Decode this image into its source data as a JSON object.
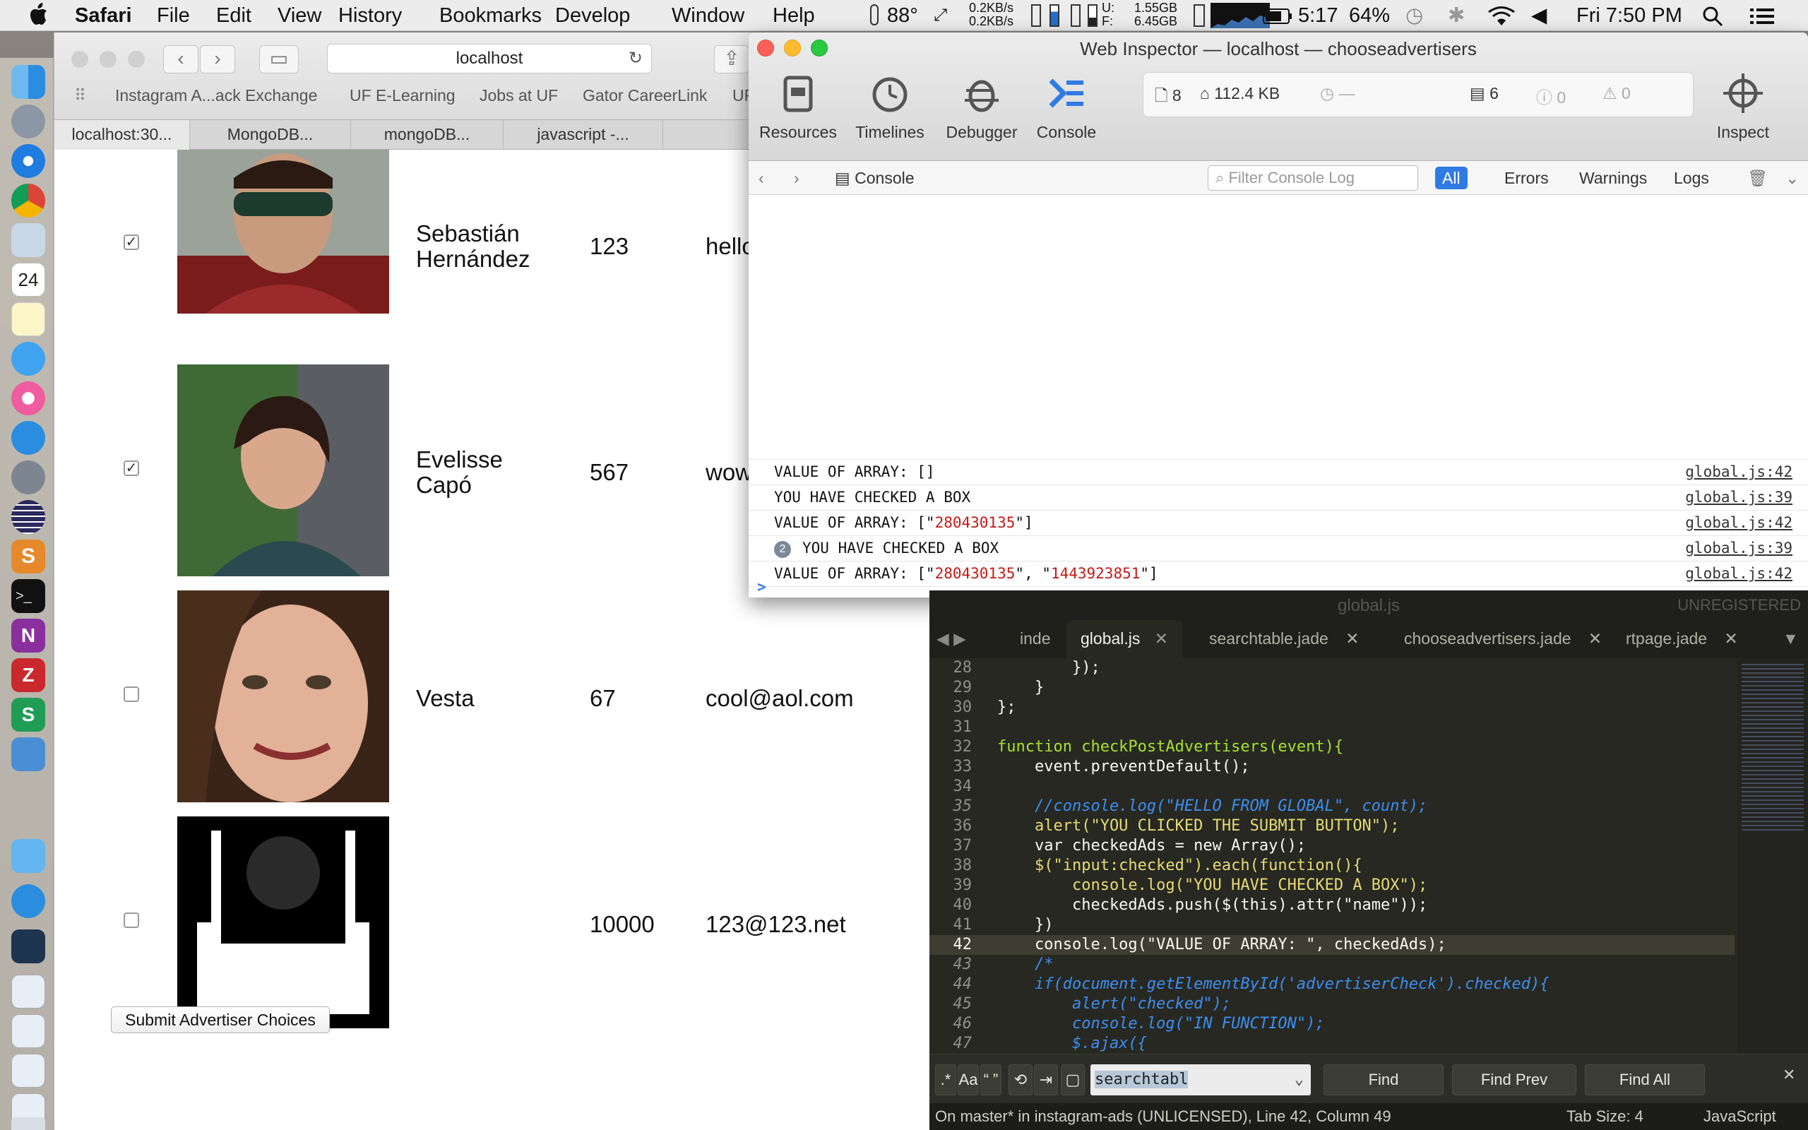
{
  "menubar": {
    "app": "Safari",
    "menus": [
      "File",
      "Edit",
      "View",
      "History",
      "Bookmarks",
      "Develop",
      "Window",
      "Help"
    ],
    "temp": "88°",
    "net_up": "0.2KB/s",
    "net_down": "0.2KB/s",
    "mem_u_label": "U:",
    "mem_f_label": "F:",
    "mem_used": "1.55GB",
    "mem_free": "6.45GB",
    "time": "5:17",
    "battery": "64%",
    "clock": "Fri 7:50 PM"
  },
  "safari": {
    "url": "localhost",
    "bookmarks": [
      "Instagram A...ack Exchange",
      "UF E-Learning",
      "Jobs at UF",
      "Gator CareerLink",
      "UF"
    ],
    "tabs": [
      "localhost:30...",
      "MongoDB...",
      "mongoDB...",
      "javascript -..."
    ]
  },
  "page": {
    "rows": [
      {
        "checked": true,
        "first": "Sebastián",
        "last": "Hernández",
        "number": "123",
        "email": "hello"
      },
      {
        "checked": true,
        "first": "Evelisse",
        "last": "Capó",
        "number": "567",
        "email": "wow"
      },
      {
        "checked": false,
        "first": "Vesta",
        "last": "",
        "number": "67",
        "email": "cool@aol.com"
      },
      {
        "checked": false,
        "first": "",
        "last": "",
        "number": "10000",
        "email": "123@123.net"
      }
    ],
    "submit_label": "Submit Advertiser Choices"
  },
  "inspector": {
    "title": "Web Inspector — localhost — chooseadvertisers",
    "tools": [
      "Resources",
      "Timelines",
      "Debugger",
      "Console",
      "Inspect"
    ],
    "stats": {
      "resources": "8",
      "size": "112.4 KB",
      "time": "—",
      "logs": "6",
      "errors": "0",
      "warnings": "0"
    },
    "console_label": "Console",
    "filter_placeholder": "Filter Console Log",
    "filters": [
      "All",
      "Errors",
      "Warnings",
      "Logs"
    ],
    "logs": [
      {
        "prefix": "VALUE OF ARRAY:  []",
        "str": "",
        "suffix": "",
        "src": "global.js:42"
      },
      {
        "prefix": "YOU HAVE CHECKED A BOX",
        "str": "",
        "suffix": "",
        "src": "global.js:39"
      },
      {
        "prefix": "VALUE OF ARRAY:  [\"",
        "str": "280430135",
        "suffix": "\"]",
        "src": "global.js:42"
      },
      {
        "repeat": "2",
        "prefix": "YOU HAVE CHECKED A BOX",
        "str": "",
        "suffix": "",
        "src": "global.js:39"
      },
      {
        "prefix": "VALUE OF ARRAY:  [\"",
        "str": "280430135",
        "mid": "\", \"",
        "str2": "1443923851",
        "suffix": "\"]",
        "src": "global.js:42"
      }
    ],
    "prompt": ">"
  },
  "sublime": {
    "window_title": "global.js",
    "unregistered": "UNREGISTERED",
    "tabs": [
      "inde",
      "global.js",
      "searchtable.jade",
      "chooseadvertisers.jade",
      "rtpage.jade"
    ],
    "code": [
      {
        "n": "28",
        "html": "        });"
      },
      {
        "n": "29",
        "html": "    }"
      },
      {
        "n": "30",
        "html": "};"
      },
      {
        "n": "31",
        "html": ""
      },
      {
        "n": "32",
        "html": "function checkPostAdvertisers(event){"
      },
      {
        "n": "33",
        "html": "    event.preventDefault();"
      },
      {
        "n": "34",
        "html": ""
      },
      {
        "n": "35",
        "html": "    //console.log(\"HELLO FROM GLOBAL\", count);"
      },
      {
        "n": "36",
        "html": "    alert(\"YOU CLICKED THE SUBMIT BUTTON\");"
      },
      {
        "n": "37",
        "html": "    var checkedAds = new Array();"
      },
      {
        "n": "38",
        "html": "    $(\"input:checked\").each(function(){"
      },
      {
        "n": "39",
        "html": "        console.log(\"YOU HAVE CHECKED A BOX\");"
      },
      {
        "n": "40",
        "html": "        checkedAds.push($(this).attr(\"name\"));"
      },
      {
        "n": "41",
        "html": "    })"
      },
      {
        "n": "42",
        "html": "    console.log(\"VALUE OF ARRAY: \", checkedAds);"
      },
      {
        "n": "43",
        "html": "    /*"
      },
      {
        "n": "44",
        "html": "    if(document.getElementById('advertiserCheck').checked){"
      },
      {
        "n": "45",
        "html": "        alert(\"checked\");"
      },
      {
        "n": "46",
        "html": "        console.log(\"IN FUNCTION\");"
      },
      {
        "n": "47",
        "html": "        $.ajax({"
      }
    ],
    "find_value": "searchtabl",
    "find_buttons": [
      "Find",
      "Find Prev",
      "Find All"
    ],
    "find_toggles": [
      ".*",
      "Aa",
      "“ ”"
    ],
    "status_left": "On master* in instagram-ads (UNLICENSED), Line 42, Column 49",
    "tab_size": "Tab Size: 4",
    "syntax": "JavaScript"
  },
  "colors": {
    "accent": "#2f7ae5",
    "sublime_bg": "#272822",
    "error_red": "#c41a16"
  }
}
